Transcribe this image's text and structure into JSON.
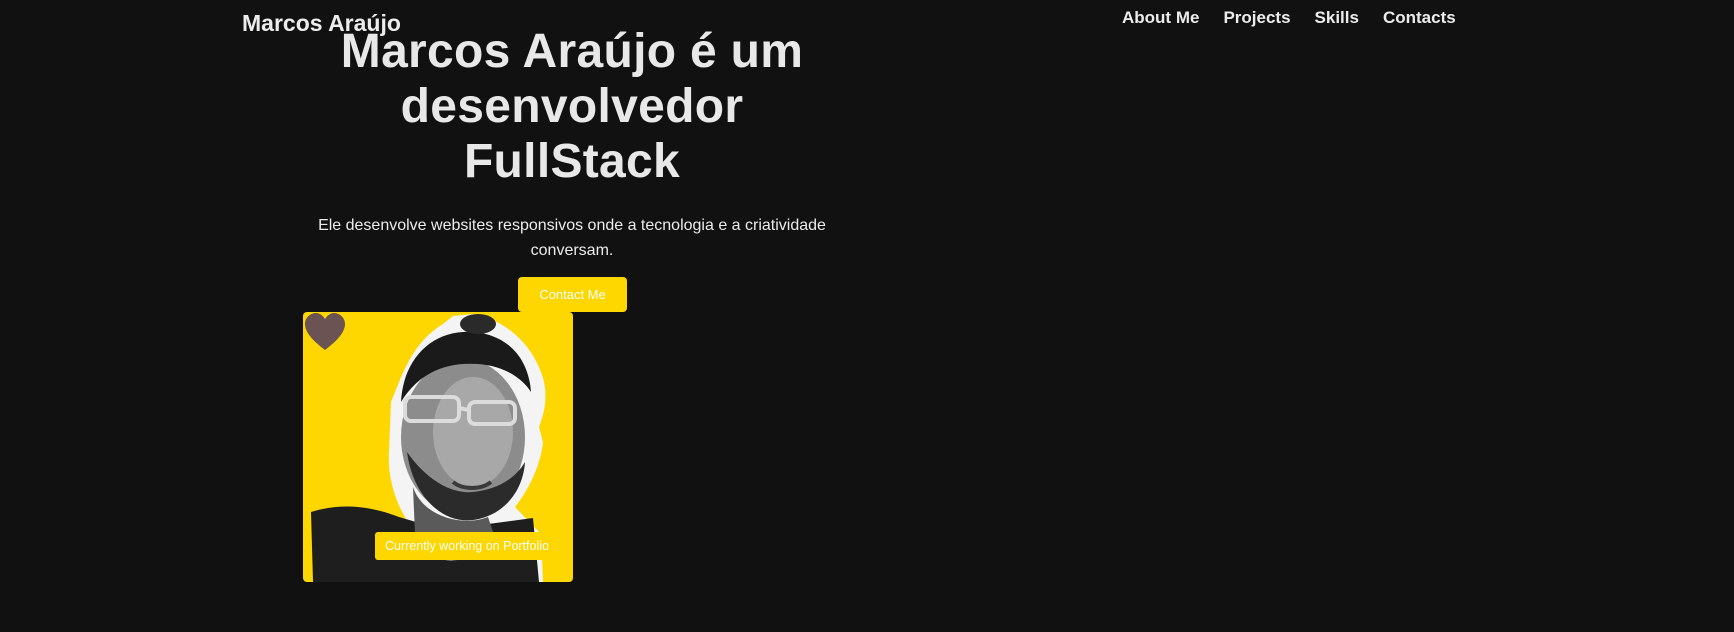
{
  "header": {
    "logo": "Marcos Araújo",
    "nav": [
      "About Me",
      "Projects",
      "Skills",
      "Contacts"
    ]
  },
  "hero": {
    "title": "Marcos Araújo é um desenvolvedor FullStack",
    "subtitle": "Ele desenvolve websites responsivos onde a tecnologia e a criatividade conversam.",
    "cta_label": "Contact Me"
  },
  "photo_card": {
    "status": "Currently working on Portfolio",
    "heart_icon": "heart-icon"
  },
  "colors": {
    "background": "#111111",
    "accent": "#ffd700",
    "text": "#ececec"
  }
}
